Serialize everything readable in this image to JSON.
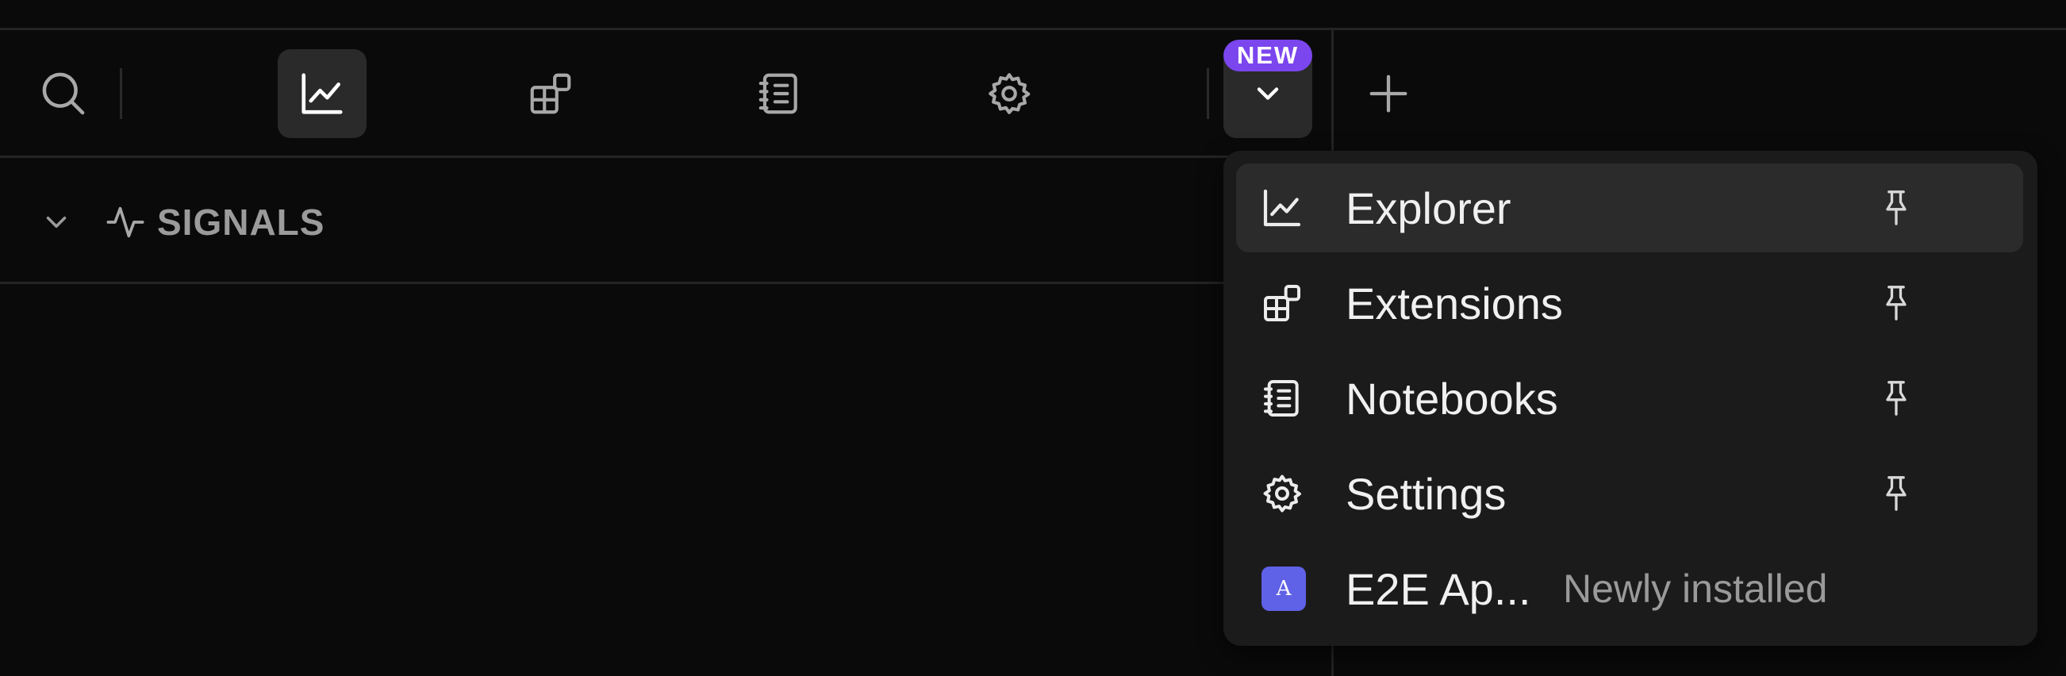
{
  "toolbar": {
    "search_icon": "search-icon",
    "tabs": [
      {
        "name": "explorer",
        "icon": "chart-line-icon",
        "active": true
      },
      {
        "name": "extensions",
        "icon": "extensions-icon",
        "active": false
      },
      {
        "name": "notebooks",
        "icon": "notebook-icon",
        "active": false
      },
      {
        "name": "settings",
        "icon": "gear-icon",
        "active": false
      }
    ],
    "dropdown_badge": "NEW",
    "dropdown_icon": "chevron-down-icon",
    "add_icon": "plus-icon"
  },
  "section": {
    "title": "SIGNALS",
    "collapse_icon": "chevron-down-icon",
    "icon": "activity-icon"
  },
  "menu": {
    "items": [
      {
        "label": "Explorer",
        "icon": "chart-line-icon",
        "pinned": true
      },
      {
        "label": "Extensions",
        "icon": "extensions-icon",
        "pinned": true
      },
      {
        "label": "Notebooks",
        "icon": "notebook-icon",
        "pinned": true
      },
      {
        "label": "Settings",
        "icon": "gear-icon",
        "pinned": true
      },
      {
        "label": "E2E Ap...",
        "avatar": "A",
        "note": "Newly installed"
      }
    ]
  },
  "colors": {
    "background": "#0a0a0a",
    "menu_background": "#1b1b1b",
    "active_button": "#2a2a2a",
    "badge": "#7b46ee",
    "app_avatar": "#5f61e6",
    "muted_text": "#9a9a9a"
  }
}
